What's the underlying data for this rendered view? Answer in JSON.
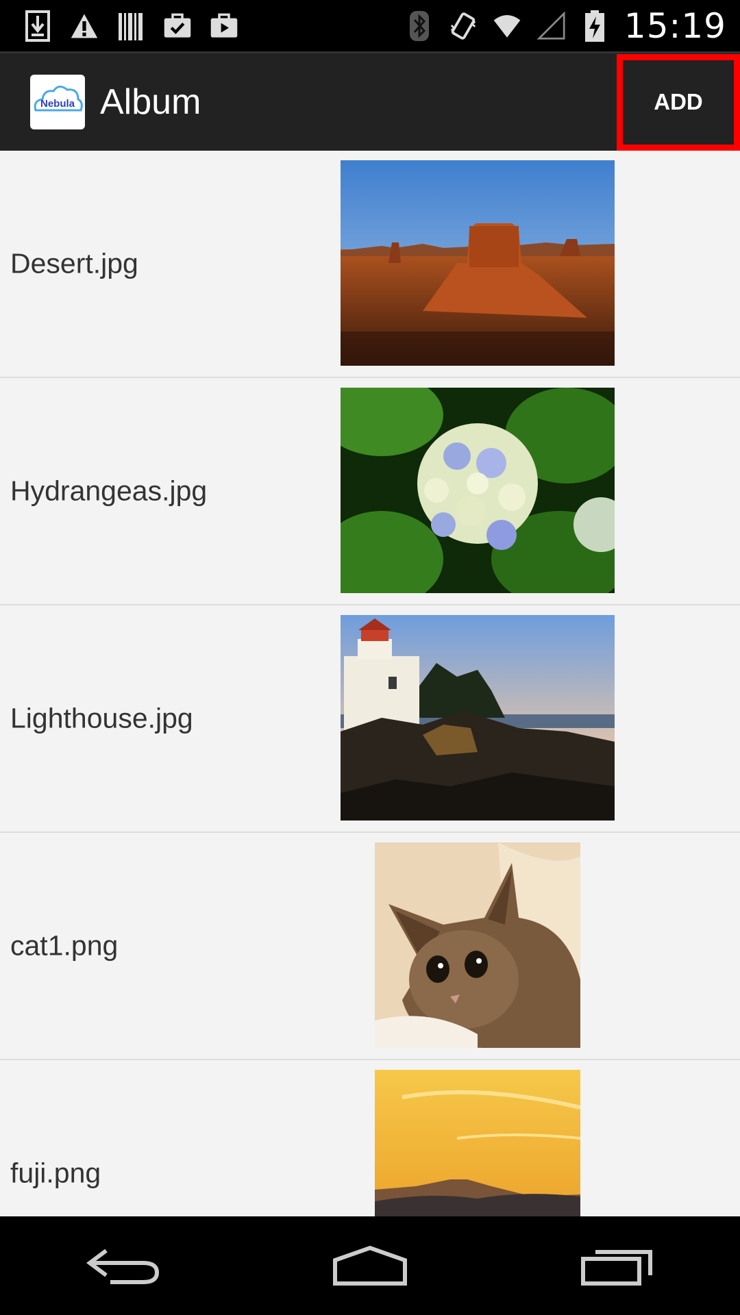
{
  "status_bar": {
    "time": "15:19",
    "left_icons": [
      "download-icon",
      "warning-icon",
      "barcode-icon",
      "briefcase-check-icon",
      "play-store-icon"
    ],
    "right_icons": [
      "bluetooth-icon",
      "vibrate-icon",
      "wifi-icon",
      "signal-icon",
      "battery-charging-icon"
    ]
  },
  "action_bar": {
    "logo_text": "Nebula",
    "title": "Album",
    "add_label": "ADD",
    "highlight_color": "#ff0000"
  },
  "album": {
    "items": [
      {
        "name": "Desert.jpg"
      },
      {
        "name": "Hydrangeas.jpg"
      },
      {
        "name": "Lighthouse.jpg"
      },
      {
        "name": "cat1.png"
      },
      {
        "name": "fuji.png"
      }
    ]
  },
  "nav_bar": {
    "buttons": [
      "back-icon",
      "home-icon",
      "recent-apps-icon"
    ]
  }
}
